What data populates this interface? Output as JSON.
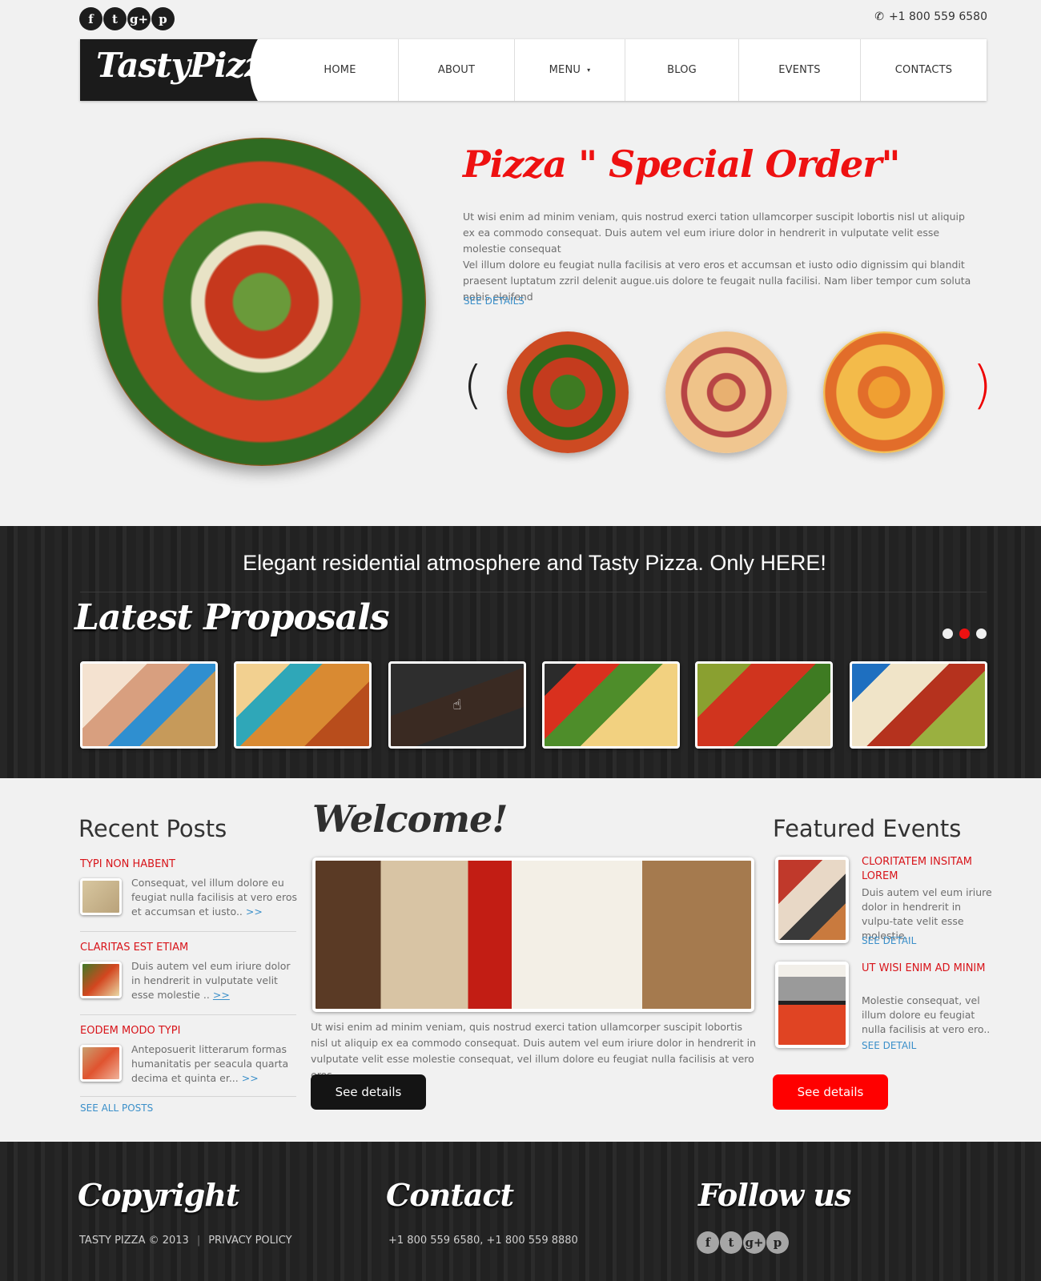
{
  "topbar": {
    "social": [
      {
        "icon": "facebook-icon",
        "glyph": "f"
      },
      {
        "icon": "twitter-icon",
        "glyph": "t"
      },
      {
        "icon": "google-plus-icon",
        "glyph": "g+"
      },
      {
        "icon": "pinterest-icon",
        "glyph": "p"
      }
    ],
    "phone": "+1 800 559 6580",
    "phone_icon": "✆"
  },
  "header": {
    "logo": "TastyPizza",
    "nav": [
      {
        "label": "HOME"
      },
      {
        "label": "ABOUT"
      },
      {
        "label": "MENU",
        "caret": "▾"
      },
      {
        "label": "BLOG"
      },
      {
        "label": "EVENTS"
      },
      {
        "label": "CONTACTS"
      }
    ]
  },
  "hero": {
    "title": "Pizza \" Special Order\"",
    "paragraph1": "Ut wisi enim ad minim veniam, quis nostrud exerci tation ullamcorper suscipit lobortis nisl ut aliquip ex ea commodo consequat. Duis autem vel eum iriure dolor in hendrerit in vulputate velit esse molestie consequat",
    "paragraph2": "Vel illum dolore eu feugiat nulla facilisis at vero eros et accumsan et iusto odio dignissim qui blandit praesent luptatum zzril delenit augue.uis dolore te feugait nulla facilisi. Nam liber tempor cum soluta nobis eleifend",
    "link": "SEE DETAILS",
    "prev": "(",
    "next": ")",
    "colors": {
      "accent": "#ee1111",
      "link": "#3a8fc9"
    }
  },
  "band": {
    "tagline": "Elegant residential atmosphere and Tasty Pizza. Only HERE!",
    "title": "Latest Proposals",
    "dots_active_index": 1,
    "dots_count": 3,
    "cursor": "☝"
  },
  "recent_posts": {
    "heading": "Recent Posts",
    "items": [
      {
        "title": "TYPI NON HABENT",
        "text": "Consequat, vel illum dolore eu feugiat nulla facilisis at vero eros et accumsan et iusto..",
        "more": ">>"
      },
      {
        "title": "CLARITAS EST ETIAM",
        "text": "Duis autem vel eum iriure dolor in hendrerit in vulputate velit esse molestie ..",
        "more": ">>"
      },
      {
        "title": "EODEM MODO TYPI",
        "text": "Anteposuerit litterarum formas humanitatis per seacula quarta decima et quinta er...",
        "more": ">>"
      }
    ],
    "see_all": "SEE ALL POSTS"
  },
  "welcome": {
    "title": "Welcome!",
    "text": "Ut wisi enim ad minim veniam, quis nostrud exerci tation ullamcorper suscipit lobortis nisl ut aliquip ex ea commodo consequat. Duis autem vel eum iriure dolor in hendrerit in vulputate velit esse molestie consequat, vel illum dolore eu feugiat nulla facilisis at vero eros.",
    "button": "See details"
  },
  "featured_events": {
    "heading": "Featured Events",
    "items": [
      {
        "title": "CLORITATEM INSITAM LOREM",
        "text": "Duis autem vel eum iriure dolor in hendrerit in vulpu-tate velit esse molestie..",
        "link": "SEE DETAIL"
      },
      {
        "title": "UT WISI ENIM AD MINIM",
        "text": "Molestie consequat, vel illum dolore eu feugiat nulla facilisis at vero ero..",
        "link": "SEE DETAIL"
      }
    ],
    "button": "See details"
  },
  "footer": {
    "copyright_heading": "Copyright",
    "copyright_text": "TASTY PIZZA © 2013",
    "separator": "|",
    "privacy": "PRIVACY POLICY",
    "contact_heading": "Contact",
    "contact_text": "+1 800 559 6580, +1 800 559 8880",
    "follow_heading": "Follow us"
  }
}
